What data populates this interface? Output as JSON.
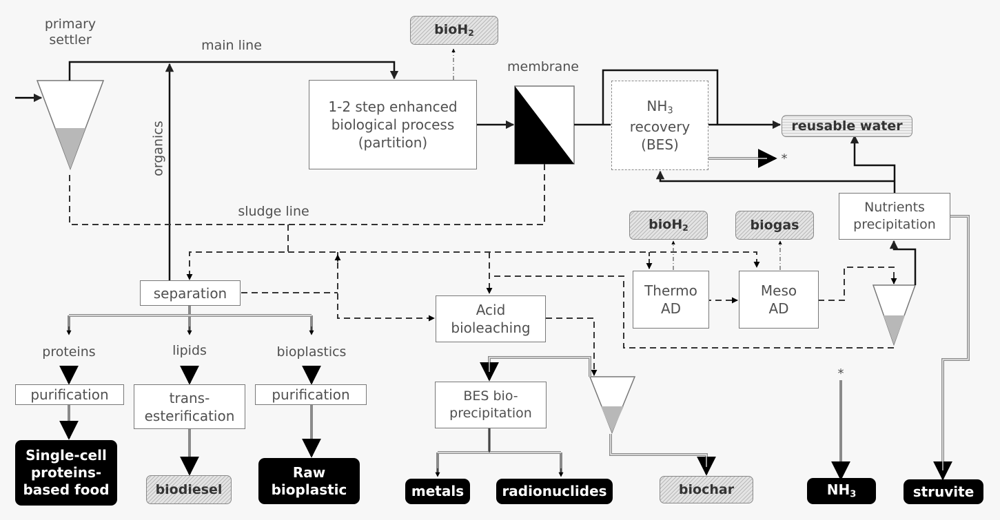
{
  "labels": {
    "primary_settler": "primary\nsettler",
    "main_line": "main line",
    "organics": "organics",
    "membrane": "membrane",
    "sludge_line": "sludge line",
    "asterisk_out": "*",
    "asterisk_in": "*"
  },
  "process_units": {
    "bio_process": [
      "1-2 step enhanced",
      "biological process",
      "(partition)"
    ],
    "nh3_recovery": {
      "main": "NH",
      "sub": "3",
      "rest": [
        "recovery",
        "(BES)"
      ]
    },
    "nutrients_precipitation": [
      "Nutrients",
      "precipitation"
    ],
    "separation": "separation",
    "acid_bioleaching": [
      "Acid",
      "bioleaching"
    ],
    "thermo_ad": [
      "Thermo",
      "AD"
    ],
    "meso_ad": [
      "Meso",
      "AD"
    ],
    "bes_bioprecipitation": [
      "BES bio-",
      "precipitation"
    ],
    "purification_proteins": "purification",
    "transesterification": [
      "trans-",
      "esterification"
    ],
    "purification_bioplastics": "purification"
  },
  "streams": {
    "proteins": "proteins",
    "lipids": "lipids",
    "bioplastics": "bioplastics"
  },
  "energy_products": {
    "bioh2_top": {
      "main": "bioH",
      "sub": "2"
    },
    "bioh2_thermo": {
      "main": "bioH",
      "sub": "2"
    },
    "biogas": "biogas",
    "biodiesel": "biodiesel",
    "biochar": "biochar"
  },
  "water_product": "reusable water",
  "material_products": {
    "scp_food": [
      "Single-cell",
      "proteins-",
      "based food"
    ],
    "raw_bioplastic": [
      "Raw",
      "bioplastic"
    ],
    "metals": "metals",
    "radionuclides": "radionuclides",
    "nh3": {
      "main": "NH",
      "sub": "3"
    },
    "struvite": "struvite"
  },
  "legend_colors": {
    "main_line": "#111111",
    "sludge_line": "#333333",
    "product_line": "#8a8a8a",
    "material_product_fill": "#000000",
    "energy_product_fill": "#e4e4e4",
    "settled_sludge_fill": "#b8b8b8"
  }
}
